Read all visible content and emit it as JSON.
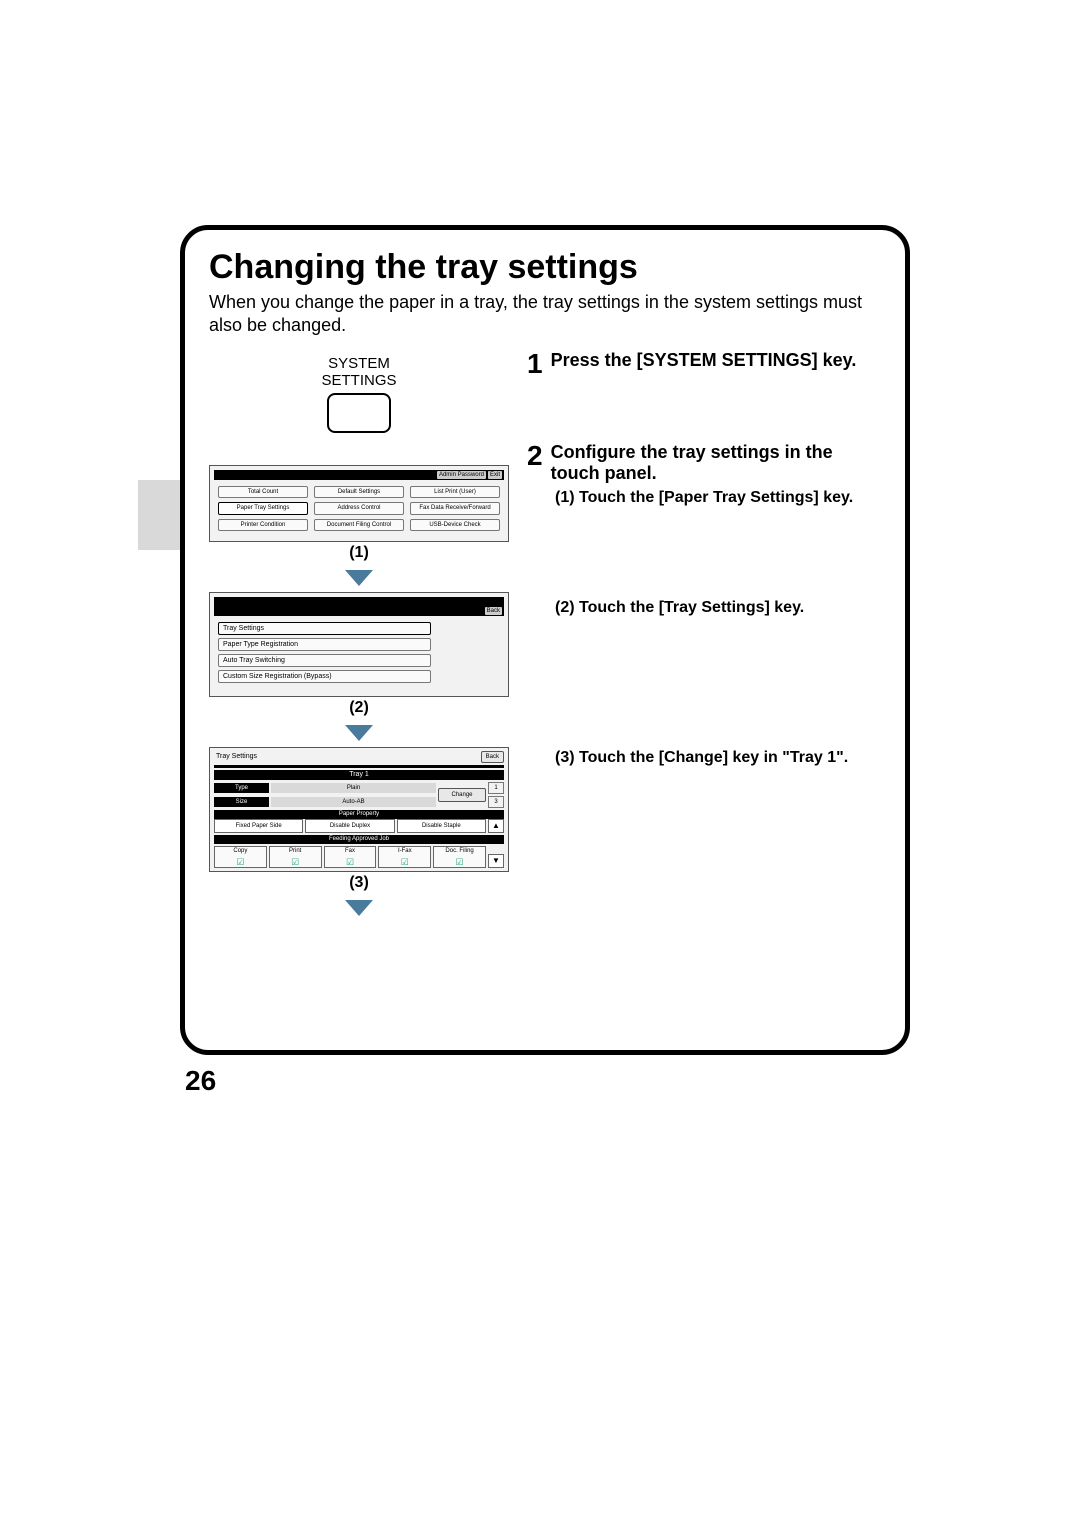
{
  "page_number": "26",
  "title": "Changing the tray settings",
  "intro": "When you change the paper in a tray, the tray settings in the system settings must also be changed.",
  "system_key": {
    "line1": "SYSTEM",
    "line2": "SETTINGS"
  },
  "steps": {
    "s1": {
      "num": "1",
      "text": "Press the [SYSTEM SETTINGS] key."
    },
    "s2": {
      "num": "2",
      "text": "Configure the tray settings in the touch panel.",
      "sub1": "(1) Touch the [Paper Tray Settings] key.",
      "sub2": "(2) Touch the [Tray Settings] key.",
      "sub3": "(3) Touch the [Change] key in \"Tray 1\"."
    }
  },
  "callouts": {
    "c1": "(1)",
    "c2": "(2)",
    "c3": "(3)"
  },
  "screen1": {
    "admin": "Admin Password",
    "exit": "Exit",
    "buttons": [
      "Total Count",
      "Default Settings",
      "List Print (User)",
      "Paper Tray Settings",
      "Address Control",
      "Fax Data Receive/Forward",
      "Printer Condition",
      "Document Filing Control",
      "USB-Device Check"
    ]
  },
  "screen2": {
    "back": "Back",
    "items": [
      "Tray Settings",
      "Paper Type Registration",
      "Auto Tray Switching",
      "Custom Size Registration (Bypass)"
    ]
  },
  "screen3": {
    "title": "Tray Settings",
    "back": "Back",
    "tray_label": "Tray 1",
    "type_label": "Type",
    "type_value": "Plain",
    "size_label": "Size",
    "size_value": "Auto-AB",
    "change": "Change",
    "counter_top": "1",
    "counter_bot": "3",
    "paper_prop": "Paper Property",
    "props": [
      "Fixed Paper Side",
      "Disable Duplex",
      "Disable Staple"
    ],
    "feed_bar": "Feeding Approved Job",
    "jobs": [
      "Copy",
      "Print",
      "Fax",
      "I-Fax",
      "Doc. Filing"
    ]
  }
}
